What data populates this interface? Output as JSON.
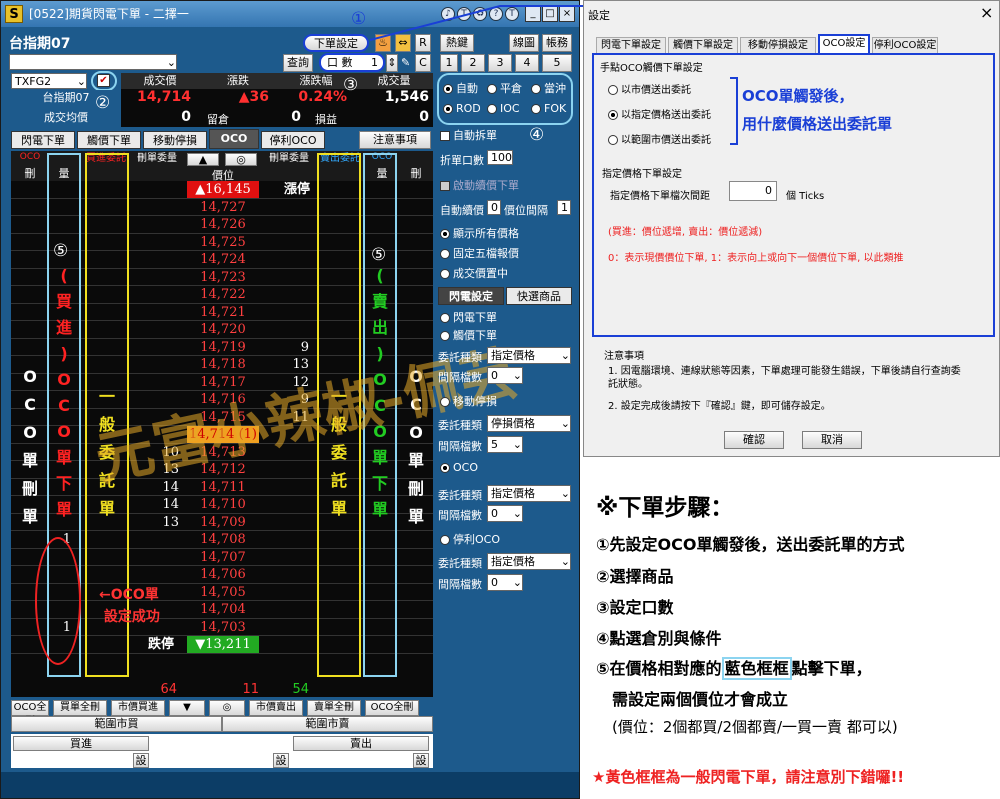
{
  "window": {
    "title": "[0522]期貨閃電下單 - 二擇一",
    "logo": "S",
    "controls": [
      "_",
      "□",
      "×"
    ],
    "circles": [
      "♪",
      "T",
      "♻",
      "?",
      "T"
    ]
  },
  "toolbar": {
    "product_name": "台指期07",
    "order_setting": "下單設定",
    "r_btn": "R",
    "query": "查詢",
    "lots_label": "口 數",
    "lots": "1",
    "c_btn": "C",
    "hot_keys": "熱鍵",
    "line_chart": "線圖",
    "account": "帳務",
    "nums": [
      "1",
      "2",
      "3",
      "4",
      "5"
    ]
  },
  "quote": {
    "symbol": "TXFG2",
    "product": "台指期07",
    "headers": [
      "成交價",
      "漲跌",
      "漲跌幅",
      "成交量"
    ],
    "price": "14,714",
    "change": "▲36",
    "pct": "0.24%",
    "volume": "1,546",
    "avg_label": "成交均價",
    "avg": "0",
    "position_label": "留倉",
    "position": "0",
    "pl_label": "損益",
    "pl": "0"
  },
  "order_opts": {
    "row1": [
      "自動",
      "平倉",
      "當沖"
    ],
    "row2": [
      "ROD",
      "IOC",
      "FOK"
    ],
    "auto_split": "自動拆單",
    "split_lots": "折單口數",
    "split_val": "100",
    "start_reprice": "啟動續價下單",
    "auto_reprice": "自動續價",
    "reprice_val": "0",
    "gap_label": "價位間隔",
    "gap_val": "1",
    "show_all": "顯示所有價格",
    "fixed5": "固定五檔報價",
    "center": "成交價置中",
    "tab_flash": "閃電設定",
    "tab_quick": "快選商品",
    "flash_order": "閃電下單",
    "touch_order": "觸價下單",
    "type_label": "委託種類",
    "type_val": "指定價格",
    "gap2": "間隔檔數",
    "gap2_val": "0",
    "move_stop": "移動停損",
    "stop_type": "停損價格",
    "gap3_val": "5",
    "oco": "OCO",
    "oco_type": "指定價格",
    "gap4_val": "0",
    "stop_oco": "停利OCO",
    "stop_oco_type": "指定價格",
    "gap5_val": "0"
  },
  "tabs": [
    "閃電下單",
    "觸價下單",
    "移動停損",
    "OCO",
    "停利OCO"
  ],
  "notice": "注意事項",
  "ladder_hdr": [
    "刪",
    "量",
    "買進委託",
    "刪單委量",
    "▲",
    "◎",
    "價位",
    "刪單委量",
    "賣出委託",
    "量",
    "刪"
  ],
  "prices": [
    "▲16,145",
    "14,727",
    "14,726",
    "14,725",
    "14,724",
    "14,723",
    "14,722",
    "14,721",
    "14,720",
    "14,719",
    "14,718",
    "14,717",
    "14,716",
    "14,715",
    "14,714 (1)",
    "14,713",
    "14,712",
    "14,711",
    "14,710",
    "14,709",
    "14,708",
    "14,707",
    "14,706",
    "14,705",
    "14,704",
    "14,703",
    "▼13,211"
  ],
  "limit_up": "漲停",
  "limit_down": "跌停",
  "ask_vols": {
    "9": "9",
    "10": "13",
    "11": "12",
    "12": "9",
    "13": "11"
  },
  "bid_vols": {
    "15": "10",
    "16": "13",
    "17": "14",
    "18": "14",
    "19": "13"
  },
  "oco_buy_qty": {
    "20": "1",
    "25": "1"
  },
  "totals": {
    "buy": "64",
    "mid": "11",
    "sell": "54"
  },
  "left_label_oco": [
    "O",
    "C",
    "O",
    "單",
    "刪",
    "單"
  ],
  "buy_label": [
    "(",
    "買",
    "進",
    ")",
    "O",
    "C",
    "O",
    "單",
    "下",
    "單"
  ],
  "sell_label": [
    "(",
    "賣",
    "出",
    ")",
    "O",
    "C",
    "O",
    "單",
    "下",
    "單"
  ],
  "general": [
    "一",
    "般",
    "委",
    "託",
    "單"
  ],
  "annot": {
    "oco_success": "←OCO單\n 設定成功",
    "watermark": "元富小辣椒-佩芸"
  },
  "bottom": {
    "row1": [
      "OCO全刪",
      "買單全刪",
      "市價買進",
      "▼",
      "◎",
      "市價賣出",
      "賣單全刪",
      "OCO全刪"
    ],
    "range_buy": "範圍市買",
    "range_sell": "範圍市賣",
    "buy": "買進",
    "sell": "賣出",
    "set": "設"
  },
  "dialog": {
    "title": "設定",
    "close": "×",
    "tabs": [
      "閃電下單設定",
      "觸價下單設定",
      "移動停損設定",
      "OCO設定",
      "停利OCO設定"
    ],
    "g1": "手點OCO觸價下單設定",
    "r1": "以市價送出委託",
    "r2": "以指定價格送出委託",
    "r3": "以範圍市價送出委託",
    "annot1": "OCO單觸發後，",
    "annot2": "用什麼價格送出委託單",
    "g2": "指定價格下單設定",
    "tick_label": "指定價格下單檔次間距",
    "tick_val": "0",
    "ticks": "個 Ticks",
    "note1": "(買進：價位遞增, 賣出：價位遞減)",
    "note2": "0：表示現價價位下單, 1：表示向上或向下一個價位下單, 以此類推",
    "notice_title": "注意事項",
    "n1": "1.  因電腦環境、連線狀態等因素，下單處理可能發生錯誤，下單後請自行查詢委託狀態。",
    "n2": "2.  設定完成後請按下『確認』鍵，即可儲存設定。",
    "ok": "確認",
    "cancel": "取消"
  },
  "steps": {
    "title": "※下單步驟：",
    "s1": "①先設定OCO單觸發後，送出委託單的方式",
    "s2": "②選擇商品",
    "s3": "③設定口數",
    "s4": "④點選倉別與條件",
    "s5a": "⑤在價格相對應的",
    "s5b": "藍色框框",
    "s5c": "點擊下單，",
    "s5d": "需設定兩個價位才會成立",
    "s5e": "(價位：2個都買/2個都賣/一買一賣 都可以)",
    "warn": "★黃色框框為一般閃電下單，請注意別下錯囉!!"
  },
  "markers": [
    "①",
    "②",
    "③",
    "④",
    "⑤",
    "⑤"
  ],
  "colors": {
    "accent": "#1d5a8c",
    "blue_annot": "#1a3fd6",
    "red": "#ff3030",
    "yellow": "#f0e020"
  }
}
